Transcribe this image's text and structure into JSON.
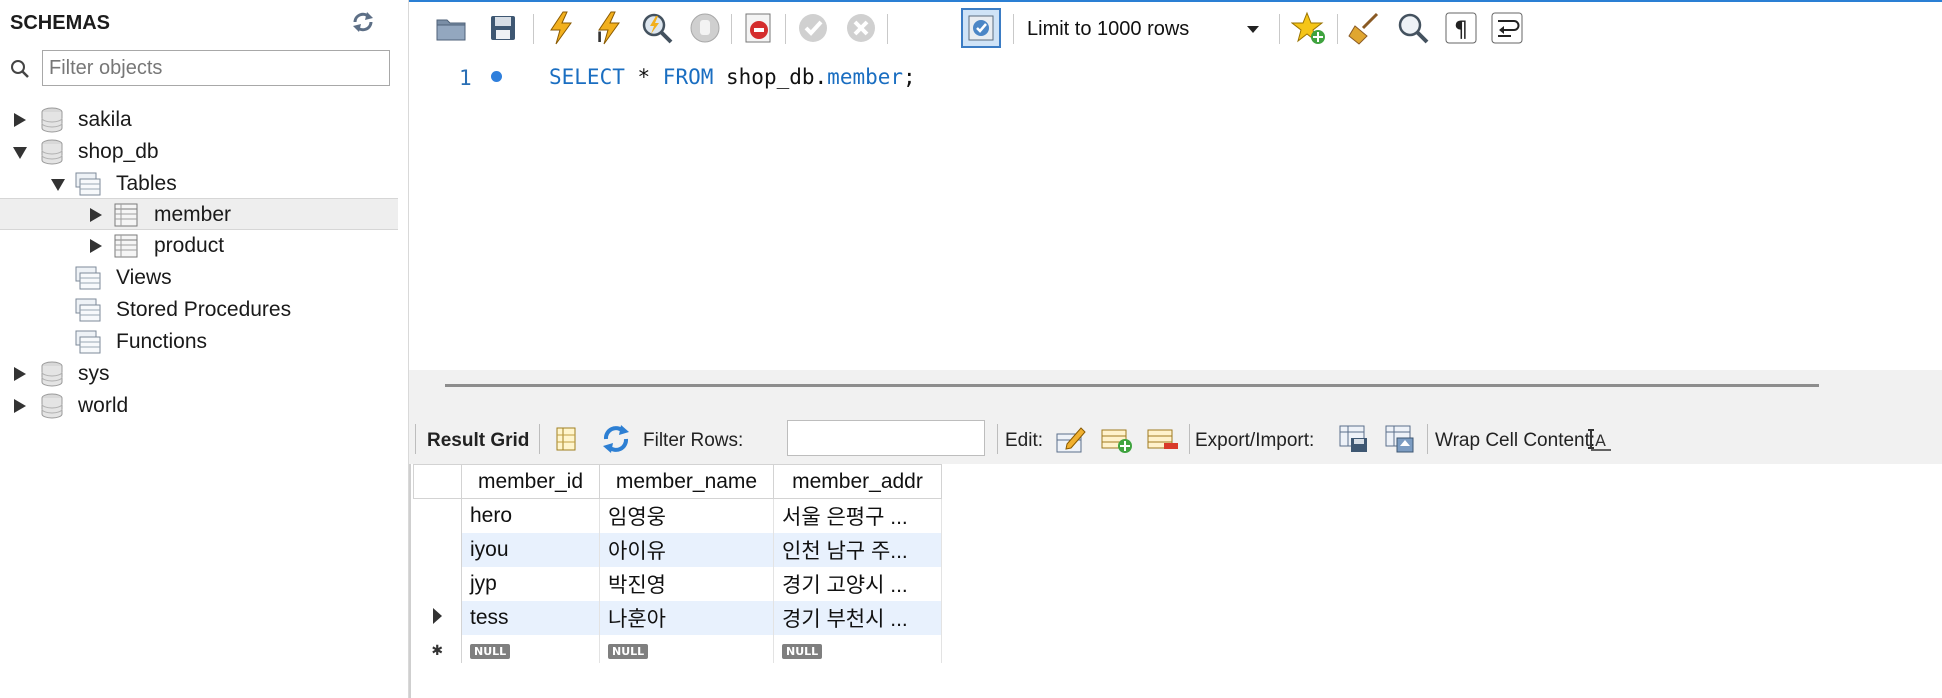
{
  "navigator": {
    "title": "SCHEMAS",
    "filter_placeholder": "Filter objects",
    "tree": {
      "sakila": "sakila",
      "shop_db": "shop_db",
      "tables": "Tables",
      "member": "member",
      "product": "product",
      "views": "Views",
      "stored_procedures": "Stored Procedures",
      "functions": "Functions",
      "sys": "sys",
      "world": "world"
    }
  },
  "toolbar": {
    "limit_label": "Limit to 1000 rows"
  },
  "editor": {
    "line_number": "1",
    "code": {
      "select": "SELECT",
      "star": " * ",
      "from": "FROM",
      "schema": " shop_db.",
      "table": "member",
      "semicolon": ";"
    }
  },
  "result_toolbar": {
    "result_grid": "Result Grid",
    "filter_rows": "Filter Rows:",
    "edit": "Edit:",
    "export_import": "Export/Import:",
    "wrap": "Wrap Cell Content:"
  },
  "grid": {
    "columns": [
      "member_id",
      "member_name",
      "member_addr"
    ],
    "rows": [
      [
        "hero",
        "임영웅",
        "서울 은평구 ..."
      ],
      [
        "iyou",
        "아이유",
        "인천 남구 주..."
      ],
      [
        "jyp",
        "박진영",
        "경기 고양시 ..."
      ],
      [
        "tess",
        "나훈아",
        "경기 부천시 ..."
      ]
    ],
    "null_label": "NULL"
  },
  "colors": {
    "keyword": "#1a6ec1",
    "selection_row": "#e8f1fd",
    "accent": "#2a7fd4"
  }
}
